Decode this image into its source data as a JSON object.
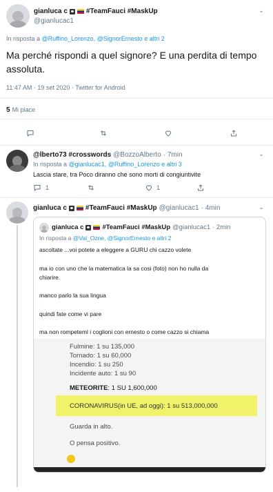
{
  "main_tweet": {
    "display_name": "gianluca c",
    "hashtags": "#TeamFauci #MaskUp",
    "handle": "@gianlucac1",
    "reply_prefix": "In risposta a",
    "reply_to_users": "@Ruffino_Lorenzo, @SignorErnesto e altri 2",
    "text": "Ma perché rispondi a quel signore? E una perdita di tempo assoluta.",
    "timestamp": "11:47 AM · 19 set 2020 · Twitter for Android",
    "likes_count": "5",
    "likes_label": "Mi piace"
  },
  "reply_1": {
    "display_name": "@lberto73 #crosswords",
    "handle": "@BozzoAlberto",
    "time": "· 7min",
    "reply_prefix": "In risposta a",
    "reply_to_users": "@gianlucac1, @Ruffino_Lorenzo e altri 3",
    "text": "Lascia stare, tra Poco diranno che sono morti di congiuntivite",
    "reply_count": "1",
    "like_count": "1"
  },
  "reply_2": {
    "display_name": "gianluca c",
    "hashtags": "#TeamFauci #MaskUp",
    "handle": "@gianlucac1",
    "time": "· 4min"
  },
  "quoted": {
    "display_name": "gianluca c",
    "hashtags": "#TeamFauci #MaskUp",
    "handle": "@gianlucac1",
    "time": "· 2min",
    "reply_prefix": "In risposta a",
    "reply_to_users": "@Val_Ozne, @SignorErnesto e altri 2",
    "lines": [
      "ascoltate ...voi potete a eleggere a GURU chi cazzo volete",
      "ma io con uno che la matematica la sa cosi (foto) non ho nulla da",
      "chiarire.",
      "manco parlo la sua lingua",
      "quindi fate come vi pare",
      "ma non rompeteml i coglioni con ernesto o come cazzo si chiama"
    ],
    "media": {
      "stats": [
        "Fulmine: 1 su 135,000",
        "Tornado: 1 su 60,000",
        "Incendio: 1 su 250",
        "Incidente auto: 1 su 90"
      ],
      "meteorite_label": "METEORITE",
      "meteorite_value": ": 1 SU 1,600,000",
      "coronavirus": "CORONAVIRUS(in UE, ad oggi): 1 su 513,000,000",
      "guarda": "Guarda in alto.",
      "pensa": "O pensa positivo."
    }
  },
  "colors": {
    "link": "#1b95e0",
    "muted": "#657786",
    "highlight": "#f0f26a"
  }
}
